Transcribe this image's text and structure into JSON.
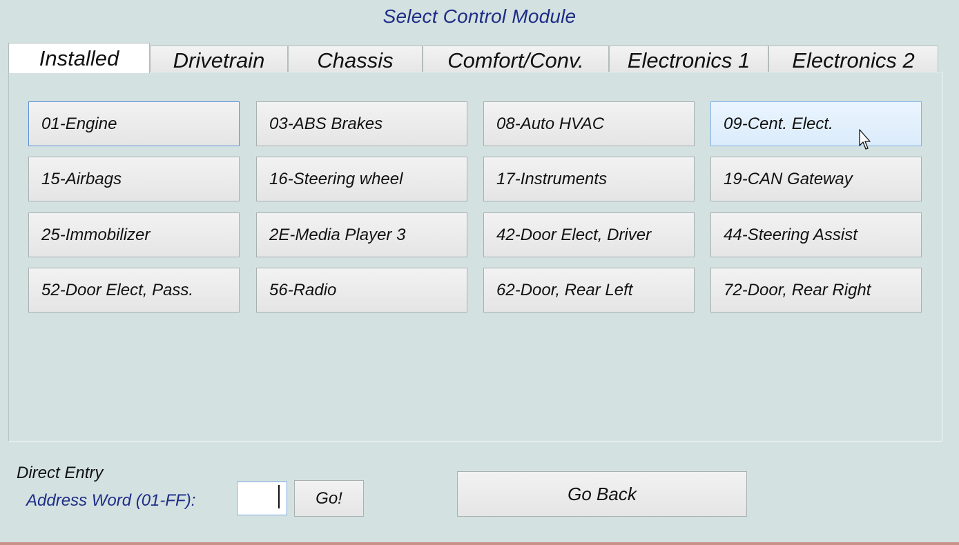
{
  "window": {
    "title": "Select Control Module"
  },
  "tabs": [
    {
      "label": "Installed",
      "active": true
    },
    {
      "label": "Drivetrain",
      "active": false
    },
    {
      "label": "Chassis",
      "active": false
    },
    {
      "label": "Comfort/Conv.",
      "active": false
    },
    {
      "label": "Electronics 1",
      "active": false
    },
    {
      "label": "Electronics 2",
      "active": false
    }
  ],
  "modules": [
    {
      "label": "01-Engine",
      "state": "focused"
    },
    {
      "label": "03-ABS Brakes",
      "state": "normal"
    },
    {
      "label": "08-Auto HVAC",
      "state": "normal"
    },
    {
      "label": "09-Cent. Elect.",
      "state": "hover"
    },
    {
      "label": "15-Airbags",
      "state": "normal"
    },
    {
      "label": "16-Steering wheel",
      "state": "normal"
    },
    {
      "label": "17-Instruments",
      "state": "normal"
    },
    {
      "label": "19-CAN Gateway",
      "state": "normal"
    },
    {
      "label": "25-Immobilizer",
      "state": "normal"
    },
    {
      "label": "2E-Media Player 3",
      "state": "normal"
    },
    {
      "label": "42-Door Elect, Driver",
      "state": "normal"
    },
    {
      "label": "44-Steering Assist",
      "state": "normal"
    },
    {
      "label": "52-Door Elect, Pass.",
      "state": "normal"
    },
    {
      "label": "56-Radio",
      "state": "normal"
    },
    {
      "label": "62-Door, Rear Left",
      "state": "normal"
    },
    {
      "label": "72-Door, Rear Right",
      "state": "normal"
    }
  ],
  "direct_entry": {
    "heading": "Direct Entry",
    "address_label": "Address Word (01-FF):",
    "address_value": "",
    "go_label": "Go!"
  },
  "footer": {
    "go_back_label": "Go Back"
  },
  "colors": {
    "background": "#d3e1e1",
    "title_text": "#1f2d86",
    "hover_button": "#dbecfb",
    "focus_border": "#5b8fd6"
  }
}
